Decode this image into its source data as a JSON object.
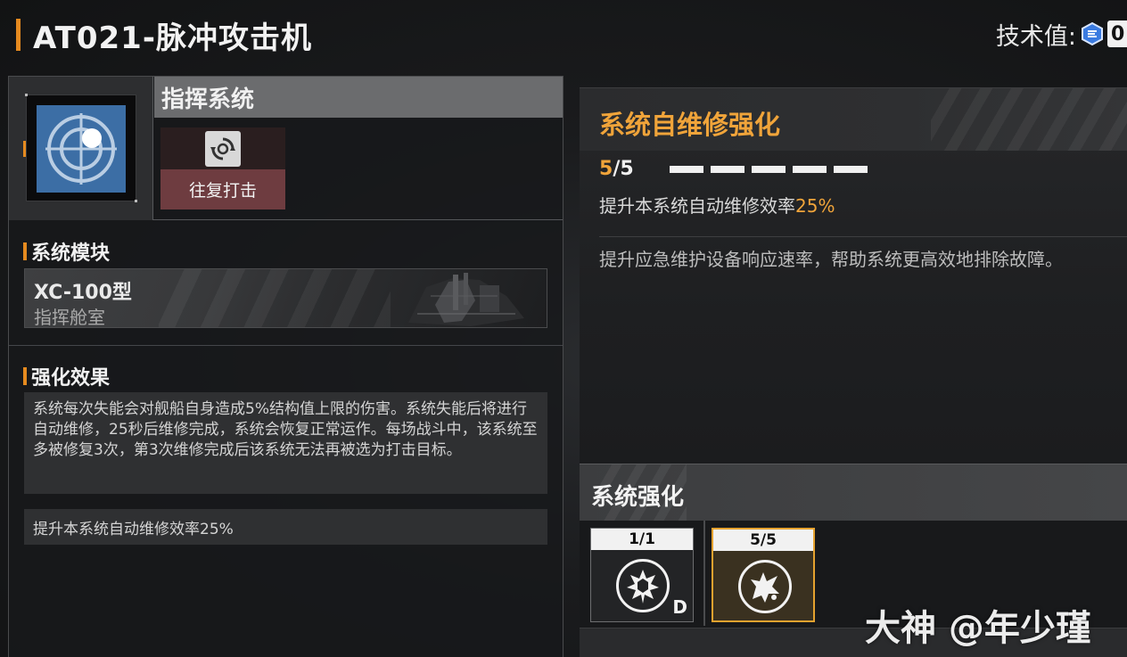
{
  "header": {
    "title": "AT021-脉冲攻击机",
    "tech_label": "技术值:",
    "tech_icon": "tech-value-icon",
    "tech_value": "0"
  },
  "system": {
    "name": "指挥系统",
    "icon": "crosshair-icon",
    "skill": {
      "label": "往复打击",
      "icon": "cycle-strike-icon"
    }
  },
  "module_section": {
    "title": "系统模块",
    "model": "XC-100型",
    "name": "指挥舱室"
  },
  "effect_section": {
    "title": "强化效果",
    "description": "系统每次失能会对舰船自身造成5%结构值上限的伤害。系统失能后将进行自动维修，25秒后维修完成，系统会恢复正常运作。每场战斗中，该系统至多被修复3次，第3次维修完成后该系统无法再被选为打击目标。",
    "bonus": "提升本系统自动维修效率25%"
  },
  "detail": {
    "title": "系统自维修强化",
    "level_current": "5",
    "level_rest": "/5",
    "pips_filled": 5,
    "pips_total": 5,
    "effect_prefix": "提升本系统自动维修效率",
    "effect_value": "25%",
    "description": "提升应急维护设备响应速率，帮助系统更高效地排除故障。"
  },
  "enhancement": {
    "title": "系统强化",
    "cards": [
      {
        "level": "1/1",
        "icon": "burst-shield-icon",
        "badge": "D",
        "active": false
      },
      {
        "level": "5/5",
        "icon": "explosion-icon",
        "badge": "",
        "active": true
      }
    ]
  },
  "watermark": "大神 @年少瑾",
  "colors": {
    "accent": "#e58a1f",
    "highlight": "#f0a43a",
    "skill_card": "#6e3c40",
    "system_icon_bg": "#3c6ea5"
  }
}
